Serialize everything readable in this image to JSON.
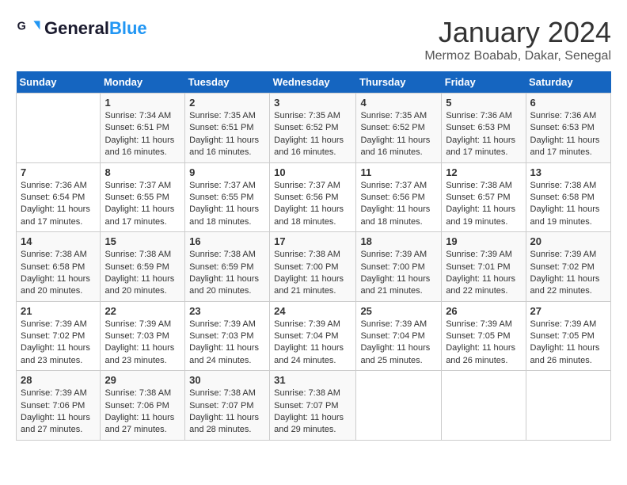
{
  "header": {
    "logo_line1": "General",
    "logo_line2": "Blue",
    "title": "January 2024",
    "subtitle": "Mermoz Boabab, Dakar, Senegal"
  },
  "days_of_week": [
    "Sunday",
    "Monday",
    "Tuesday",
    "Wednesday",
    "Thursday",
    "Friday",
    "Saturday"
  ],
  "weeks": [
    [
      {
        "num": "",
        "info": ""
      },
      {
        "num": "1",
        "info": "Sunrise: 7:34 AM\nSunset: 6:51 PM\nDaylight: 11 hours and 16 minutes."
      },
      {
        "num": "2",
        "info": "Sunrise: 7:35 AM\nSunset: 6:51 PM\nDaylight: 11 hours and 16 minutes."
      },
      {
        "num": "3",
        "info": "Sunrise: 7:35 AM\nSunset: 6:52 PM\nDaylight: 11 hours and 16 minutes."
      },
      {
        "num": "4",
        "info": "Sunrise: 7:35 AM\nSunset: 6:52 PM\nDaylight: 11 hours and 16 minutes."
      },
      {
        "num": "5",
        "info": "Sunrise: 7:36 AM\nSunset: 6:53 PM\nDaylight: 11 hours and 17 minutes."
      },
      {
        "num": "6",
        "info": "Sunrise: 7:36 AM\nSunset: 6:53 PM\nDaylight: 11 hours and 17 minutes."
      }
    ],
    [
      {
        "num": "7",
        "info": "Sunrise: 7:36 AM\nSunset: 6:54 PM\nDaylight: 11 hours and 17 minutes."
      },
      {
        "num": "8",
        "info": "Sunrise: 7:37 AM\nSunset: 6:55 PM\nDaylight: 11 hours and 17 minutes."
      },
      {
        "num": "9",
        "info": "Sunrise: 7:37 AM\nSunset: 6:55 PM\nDaylight: 11 hours and 18 minutes."
      },
      {
        "num": "10",
        "info": "Sunrise: 7:37 AM\nSunset: 6:56 PM\nDaylight: 11 hours and 18 minutes."
      },
      {
        "num": "11",
        "info": "Sunrise: 7:37 AM\nSunset: 6:56 PM\nDaylight: 11 hours and 18 minutes."
      },
      {
        "num": "12",
        "info": "Sunrise: 7:38 AM\nSunset: 6:57 PM\nDaylight: 11 hours and 19 minutes."
      },
      {
        "num": "13",
        "info": "Sunrise: 7:38 AM\nSunset: 6:58 PM\nDaylight: 11 hours and 19 minutes."
      }
    ],
    [
      {
        "num": "14",
        "info": "Sunrise: 7:38 AM\nSunset: 6:58 PM\nDaylight: 11 hours and 20 minutes."
      },
      {
        "num": "15",
        "info": "Sunrise: 7:38 AM\nSunset: 6:59 PM\nDaylight: 11 hours and 20 minutes."
      },
      {
        "num": "16",
        "info": "Sunrise: 7:38 AM\nSunset: 6:59 PM\nDaylight: 11 hours and 20 minutes."
      },
      {
        "num": "17",
        "info": "Sunrise: 7:38 AM\nSunset: 7:00 PM\nDaylight: 11 hours and 21 minutes."
      },
      {
        "num": "18",
        "info": "Sunrise: 7:39 AM\nSunset: 7:00 PM\nDaylight: 11 hours and 21 minutes."
      },
      {
        "num": "19",
        "info": "Sunrise: 7:39 AM\nSunset: 7:01 PM\nDaylight: 11 hours and 22 minutes."
      },
      {
        "num": "20",
        "info": "Sunrise: 7:39 AM\nSunset: 7:02 PM\nDaylight: 11 hours and 22 minutes."
      }
    ],
    [
      {
        "num": "21",
        "info": "Sunrise: 7:39 AM\nSunset: 7:02 PM\nDaylight: 11 hours and 23 minutes."
      },
      {
        "num": "22",
        "info": "Sunrise: 7:39 AM\nSunset: 7:03 PM\nDaylight: 11 hours and 23 minutes."
      },
      {
        "num": "23",
        "info": "Sunrise: 7:39 AM\nSunset: 7:03 PM\nDaylight: 11 hours and 24 minutes."
      },
      {
        "num": "24",
        "info": "Sunrise: 7:39 AM\nSunset: 7:04 PM\nDaylight: 11 hours and 24 minutes."
      },
      {
        "num": "25",
        "info": "Sunrise: 7:39 AM\nSunset: 7:04 PM\nDaylight: 11 hours and 25 minutes."
      },
      {
        "num": "26",
        "info": "Sunrise: 7:39 AM\nSunset: 7:05 PM\nDaylight: 11 hours and 26 minutes."
      },
      {
        "num": "27",
        "info": "Sunrise: 7:39 AM\nSunset: 7:05 PM\nDaylight: 11 hours and 26 minutes."
      }
    ],
    [
      {
        "num": "28",
        "info": "Sunrise: 7:39 AM\nSunset: 7:06 PM\nDaylight: 11 hours and 27 minutes."
      },
      {
        "num": "29",
        "info": "Sunrise: 7:38 AM\nSunset: 7:06 PM\nDaylight: 11 hours and 27 minutes."
      },
      {
        "num": "30",
        "info": "Sunrise: 7:38 AM\nSunset: 7:07 PM\nDaylight: 11 hours and 28 minutes."
      },
      {
        "num": "31",
        "info": "Sunrise: 7:38 AM\nSunset: 7:07 PM\nDaylight: 11 hours and 29 minutes."
      },
      {
        "num": "",
        "info": ""
      },
      {
        "num": "",
        "info": ""
      },
      {
        "num": "",
        "info": ""
      }
    ]
  ]
}
